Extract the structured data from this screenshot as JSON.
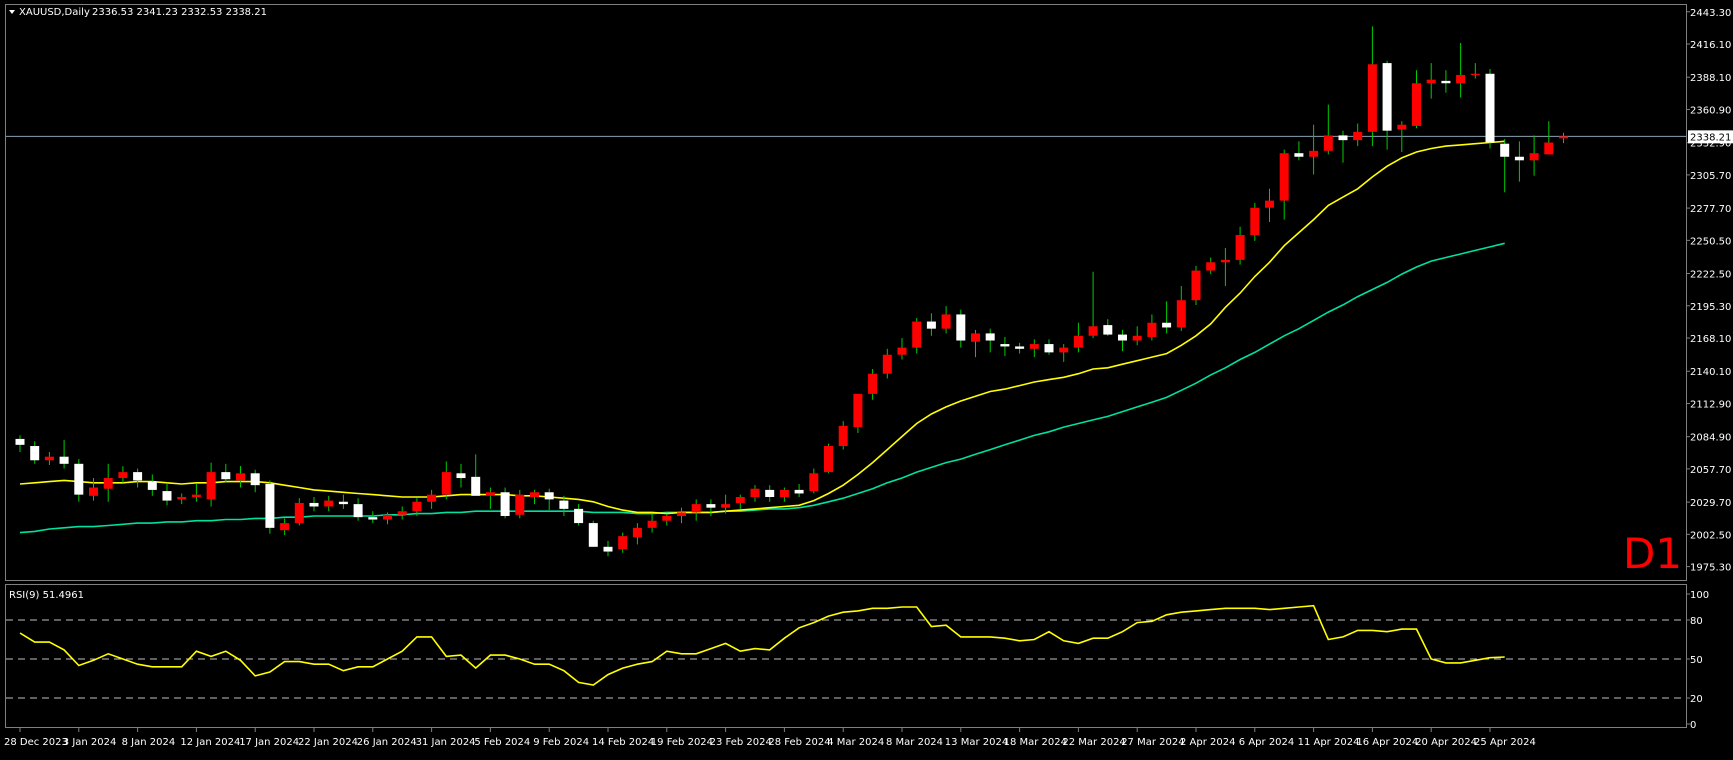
{
  "header": {
    "symbol": "XAUUSD,Daily",
    "ohlc": "2336.53 2341.23 2332.53 2338.21"
  },
  "timeframe_label": "D1",
  "current_price_label": "2338.21",
  "colors": {
    "background": "#000000",
    "bull_candle": "#ff0000",
    "bear_candle": "#ffffff",
    "ma_fast": "#ffff00",
    "ma_slow": "#00e0a0",
    "rsi_line": "#ffff00",
    "price_line": "#8aa3b5",
    "timeframe_text": "#ff0000",
    "axis_text": "#ffffff",
    "grid_dash": "#c0c0c0"
  },
  "chart_data": [
    {
      "type": "candlestick",
      "title": "XAUUSD,Daily",
      "ylim": [
        1964,
        2449
      ],
      "y_ticks": [
        2443.3,
        2416.1,
        2388.1,
        2360.9,
        2332.9,
        2305.7,
        2277.7,
        2250.5,
        2222.5,
        2195.3,
        2168.1,
        2140.1,
        2112.9,
        2084.9,
        2057.7,
        2029.7,
        2002.5,
        1975.3
      ],
      "x_ticks": [
        "28 Dec 2023",
        "3 Jan 2024",
        "8 Jan 2024",
        "12 Jan 2024",
        "17 Jan 2024",
        "22 Jan 2024",
        "26 Jan 2024",
        "31 Jan 2024",
        "5 Feb 2024",
        "9 Feb 2024",
        "14 Feb 2024",
        "19 Feb 2024",
        "23 Feb 2024",
        "28 Feb 2024",
        "4 Mar 2024",
        "8 Mar 2024",
        "13 Mar 2024",
        "18 Mar 2024",
        "22 Mar 2024",
        "27 Mar 2024",
        "2 Apr 2024",
        "6 Apr 2024",
        "11 Apr 2024",
        "16 Apr 2024",
        "20 Apr 2024",
        "25 Apr 2024"
      ],
      "x_tick_index": [
        0,
        4,
        8,
        12,
        16,
        20,
        24,
        28,
        32,
        36,
        40,
        44,
        48,
        52,
        56,
        60,
        64,
        68,
        72,
        76,
        80,
        84,
        88,
        92,
        96,
        100
      ],
      "last_price": 2338.21,
      "candles": [
        [
          2083,
          2086,
          2072,
          2078
        ],
        [
          2077,
          2081,
          2062,
          2065
        ],
        [
          2065,
          2072,
          2061,
          2068
        ],
        [
          2068,
          2082,
          2058,
          2062
        ],
        [
          2062,
          2066,
          2030,
          2036
        ],
        [
          2035,
          2050,
          2031,
          2042
        ],
        [
          2041,
          2062,
          2030,
          2050
        ],
        [
          2050,
          2060,
          2046,
          2055
        ],
        [
          2055,
          2058,
          2042,
          2048
        ],
        [
          2047,
          2053,
          2035,
          2040
        ],
        [
          2039,
          2046,
          2027,
          2031
        ],
        [
          2032,
          2037,
          2028,
          2034
        ],
        [
          2034,
          2045,
          2030,
          2036
        ],
        [
          2032,
          2063,
          2026,
          2055
        ],
        [
          2055,
          2062,
          2046,
          2049
        ],
        [
          2048,
          2060,
          2042,
          2054
        ],
        [
          2054,
          2057,
          2038,
          2044
        ],
        [
          2045,
          2048,
          2003,
          2008
        ],
        [
          2006,
          2016,
          2002,
          2012
        ],
        [
          2012,
          2033,
          2010,
          2029
        ],
        [
          2029,
          2034,
          2022,
          2026
        ],
        [
          2026,
          2035,
          2022,
          2031
        ],
        [
          2030,
          2036,
          2024,
          2028
        ],
        [
          2028,
          2033,
          2014,
          2017
        ],
        [
          2017,
          2022,
          2012,
          2015
        ],
        [
          2015,
          2021,
          2011,
          2019
        ],
        [
          2019,
          2026,
          2015,
          2022
        ],
        [
          2022,
          2033,
          2018,
          2030
        ],
        [
          2030,
          2040,
          2024,
          2036
        ],
        [
          2036,
          2064,
          2032,
          2055
        ],
        [
          2054,
          2062,
          2042,
          2050
        ],
        [
          2051,
          2070,
          2036,
          2035
        ],
        [
          2035,
          2042,
          2024,
          2038
        ],
        [
          2038,
          2042,
          2016,
          2018
        ],
        [
          2019,
          2040,
          2016,
          2036
        ],
        [
          2034,
          2040,
          2028,
          2038
        ],
        [
          2038,
          2041,
          2023,
          2032
        ],
        [
          2031,
          2035,
          2018,
          2024
        ],
        [
          2024,
          2028,
          2010,
          2012
        ],
        [
          2012,
          2014,
          1992,
          1992
        ],
        [
          1992,
          1997,
          1984,
          1988
        ],
        [
          1990,
          2004,
          1987,
          2001
        ],
        [
          2000,
          2012,
          1994,
          2008
        ],
        [
          2008,
          2020,
          2004,
          2014
        ],
        [
          2014,
          2020,
          2010,
          2018
        ],
        [
          2018,
          2025,
          2012,
          2021
        ],
        [
          2021,
          2032,
          2014,
          2028
        ],
        [
          2028,
          2032,
          2018,
          2025
        ],
        [
          2025,
          2036,
          2020,
          2028
        ],
        [
          2029,
          2036,
          2024,
          2034
        ],
        [
          2034,
          2044,
          2030,
          2041
        ],
        [
          2040,
          2044,
          2030,
          2034
        ],
        [
          2034,
          2042,
          2030,
          2040
        ],
        [
          2040,
          2045,
          2034,
          2037
        ],
        [
          2039,
          2058,
          2037,
          2054
        ],
        [
          2055,
          2079,
          2054,
          2077
        ],
        [
          2077,
          2098,
          2074,
          2094
        ],
        [
          2093,
          2118,
          2088,
          2121
        ],
        [
          2121,
          2142,
          2116,
          2138
        ],
        [
          2138,
          2159,
          2134,
          2154
        ],
        [
          2154,
          2168,
          2150,
          2160
        ],
        [
          2160,
          2185,
          2155,
          2182
        ],
        [
          2182,
          2189,
          2170,
          2176
        ],
        [
          2176,
          2195,
          2172,
          2188
        ],
        [
          2188,
          2192,
          2160,
          2166
        ],
        [
          2165,
          2175,
          2152,
          2172
        ],
        [
          2172,
          2176,
          2156,
          2166
        ],
        [
          2163,
          2169,
          2153,
          2161
        ],
        [
          2161,
          2164,
          2155,
          2159
        ],
        [
          2159,
          2167,
          2152,
          2163
        ],
        [
          2163,
          2167,
          2154,
          2156
        ],
        [
          2156,
          2163,
          2148,
          2160
        ],
        [
          2160,
          2181,
          2156,
          2170
        ],
        [
          2170,
          2224,
          2168,
          2178
        ],
        [
          2179,
          2184,
          2170,
          2171
        ],
        [
          2171,
          2175,
          2157,
          2166
        ],
        [
          2166,
          2178,
          2162,
          2170
        ],
        [
          2169,
          2188,
          2166,
          2181
        ],
        [
          2181,
          2199,
          2172,
          2177
        ],
        [
          2177,
          2212,
          2174,
          2200
        ],
        [
          2200,
          2229,
          2196,
          2225
        ],
        [
          2225,
          2236,
          2222,
          2232
        ],
        [
          2232,
          2244,
          2212,
          2234
        ],
        [
          2234,
          2262,
          2230,
          2255
        ],
        [
          2255,
          2282,
          2250,
          2278
        ],
        [
          2278,
          2294,
          2266,
          2284
        ],
        [
          2284,
          2327,
          2268,
          2324
        ],
        [
          2324,
          2334,
          2318,
          2321
        ],
        [
          2321,
          2348,
          2306,
          2326
        ],
        [
          2326,
          2365,
          2323,
          2339
        ],
        [
          2339,
          2343,
          2316,
          2335
        ],
        [
          2335,
          2349,
          2330,
          2342
        ],
        [
          2342,
          2431,
          2330,
          2399
        ],
        [
          2400,
          2402,
          2327,
          2343
        ],
        [
          2344,
          2351,
          2325,
          2348
        ],
        [
          2347,
          2394,
          2345,
          2383
        ],
        [
          2383,
          2400,
          2370,
          2386
        ],
        [
          2385,
          2394,
          2375,
          2383
        ],
        [
          2383,
          2417,
          2371,
          2390
        ],
        [
          2390,
          2400,
          2387,
          2391
        ],
        [
          2391,
          2395,
          2328,
          2333
        ],
        [
          2332,
          2336,
          2291,
          2321
        ],
        [
          2321,
          2334,
          2300,
          2318
        ],
        [
          2318,
          2339,
          2305,
          2324
        ],
        [
          2323,
          2351,
          2325,
          2333
        ],
        [
          2336.53,
          2341.23,
          2332.53,
          2338.21
        ]
      ],
      "ma_fast": [
        2045,
        2046,
        2047,
        2048,
        2047,
        2046,
        2046,
        2046,
        2047,
        2047,
        2046,
        2045,
        2046,
        2046,
        2047,
        2047,
        2047,
        2046,
        2044,
        2042,
        2040,
        2039,
        2038,
        2037,
        2036,
        2035,
        2034,
        2034,
        2034,
        2035,
        2036,
        2036,
        2036,
        2036,
        2035,
        2035,
        2034,
        2033,
        2032,
        2030,
        2026,
        2023,
        2021,
        2021,
        2020,
        2021,
        2021,
        2021,
        2022,
        2023,
        2024,
        2025,
        2026,
        2027,
        2031,
        2037,
        2044,
        2053,
        2063,
        2074,
        2085,
        2096,
        2104,
        2110,
        2115,
        2119,
        2123,
        2125,
        2128,
        2131,
        2133,
        2135,
        2138,
        2142,
        2143,
        2146,
        2149,
        2152,
        2155,
        2162,
        2170,
        2180,
        2194,
        2206,
        2220,
        2232,
        2246,
        2257,
        2268,
        2280,
        2287,
        2294,
        2304,
        2313,
        2320,
        2325,
        2328,
        2330,
        2331,
        2332,
        2333,
        2334
      ],
      "ma_slow": [
        2004,
        2005,
        2007,
        2008,
        2009,
        2009,
        2010,
        2011,
        2012,
        2012,
        2013,
        2013,
        2014,
        2014,
        2015,
        2015,
        2016,
        2016,
        2017,
        2017,
        2018,
        2018,
        2018,
        2018,
        2018,
        2019,
        2019,
        2020,
        2020,
        2021,
        2021,
        2022,
        2022,
        2022,
        2022,
        2022,
        2022,
        2022,
        2022,
        2021,
        2021,
        2021,
        2020,
        2020,
        2021,
        2021,
        2021,
        2021,
        2022,
        2022,
        2023,
        2024,
        2024,
        2025,
        2027,
        2030,
        2033,
        2037,
        2041,
        2046,
        2050,
        2055,
        2059,
        2063,
        2066,
        2070,
        2074,
        2078,
        2082,
        2086,
        2089,
        2093,
        2096,
        2099,
        2102,
        2106,
        2110,
        2114,
        2118,
        2124,
        2130,
        2137,
        2143,
        2150,
        2156,
        2163,
        2170,
        2176,
        2183,
        2190,
        2196,
        2203,
        2209,
        2215,
        2222,
        2228,
        2233,
        2236,
        2239,
        2242,
        2245,
        2248
      ]
    },
    {
      "type": "line",
      "title": "RSI(9) 51.4961",
      "ylim": [
        0,
        100
      ],
      "y_ticks": [
        100,
        80,
        50,
        20,
        0
      ],
      "levels": [
        80,
        50,
        20
      ],
      "values": [
        70,
        63,
        63,
        57,
        45,
        49,
        54,
        50,
        46,
        44,
        44,
        44,
        56,
        52,
        56,
        49,
        37,
        40,
        48,
        48,
        46,
        46,
        41,
        44,
        44,
        50,
        56,
        67,
        67,
        52,
        53,
        43,
        53,
        53,
        50,
        46,
        46,
        41,
        32,
        30,
        38,
        43,
        46,
        48,
        56,
        54,
        54,
        58,
        62,
        56,
        58,
        57,
        66,
        74,
        78,
        83,
        86,
        87,
        89,
        89,
        90,
        90,
        75,
        76,
        67,
        67,
        67,
        66,
        64,
        65,
        71,
        64,
        62,
        66,
        66,
        71,
        78,
        79,
        84,
        86,
        87,
        88,
        89,
        89,
        89,
        88,
        89,
        90,
        91,
        65,
        67,
        72,
        72,
        71,
        73,
        73,
        50,
        47,
        47,
        49,
        51,
        51.5
      ]
    }
  ]
}
